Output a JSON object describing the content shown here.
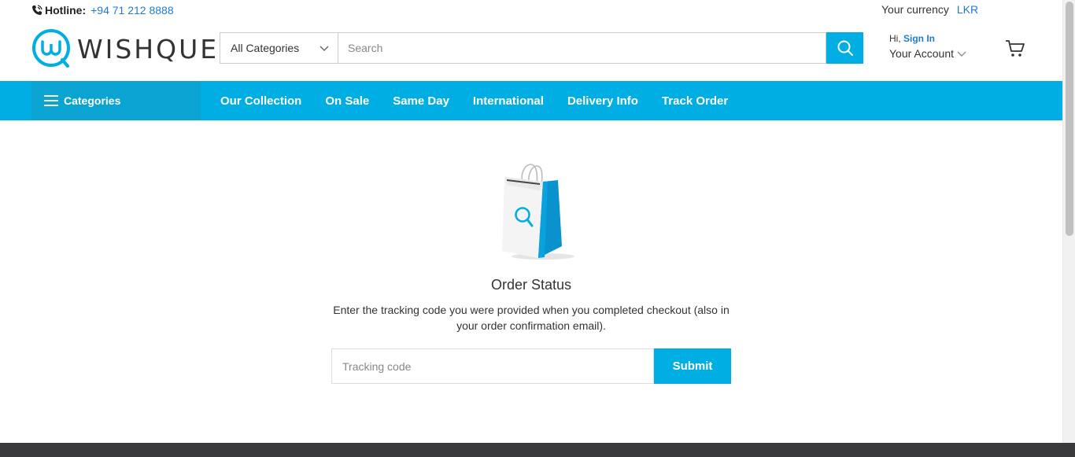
{
  "topbar": {
    "hotline_label": "Hotline:",
    "hotline_number": "+94 71 212 8888",
    "currency_label": "Your currency",
    "currency_value": "LKR"
  },
  "header": {
    "logo_text": "WISHQUE",
    "category_select": "All Categories",
    "search_placeholder": "Search",
    "account_hi": "Hi,",
    "account_signin": "Sign In",
    "account_label": "Your Account"
  },
  "nav": {
    "categories_label": "Categories",
    "links": [
      "Our Collection",
      "On Sale",
      "Same Day",
      "International",
      "Delivery Info",
      "Track Order"
    ]
  },
  "main": {
    "title": "Order Status",
    "description": "Enter the tracking code you were provided when you completed checkout (also in your order confirmation email).",
    "tracking_placeholder": "Tracking code",
    "submit_label": "Submit"
  },
  "colors": {
    "accent": "#00aee3",
    "link": "#1f7bd1",
    "footer": "#3a3a3c"
  }
}
